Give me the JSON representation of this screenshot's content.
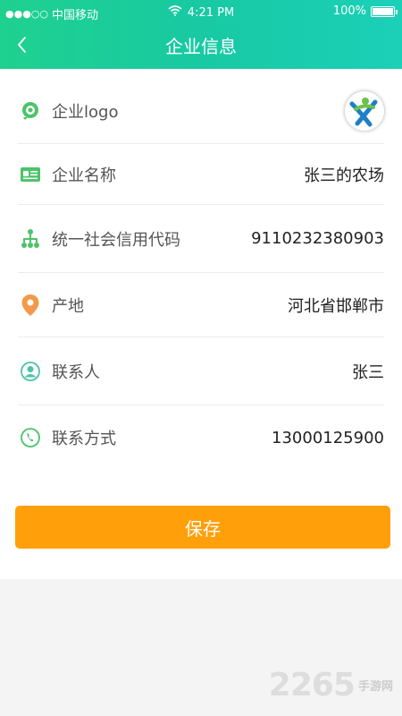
{
  "status_bar": {
    "signal": "●●●○○",
    "carrier": "中国移动",
    "time": "4:21 PM",
    "battery": "100%"
  },
  "nav": {
    "title": "企业信息"
  },
  "rows": [
    {
      "icon": "location-pin-green-icon",
      "label": "企业logo"
    },
    {
      "icon": "id-card-icon",
      "label": "企业名称",
      "value": "张三的农场"
    },
    {
      "icon": "org-tree-icon",
      "label": "统一社会信用代码",
      "value": "9110232380903"
    },
    {
      "icon": "location-pin-orange-icon",
      "label": "产地",
      "value": "河北省邯郸市"
    },
    {
      "icon": "person-icon",
      "label": "联系人",
      "value": "张三"
    },
    {
      "icon": "phone-icon",
      "label": "联系方式",
      "value": "13000125900"
    }
  ],
  "save_label": "保存",
  "watermark": {
    "number": "2265",
    "text": "手游网"
  },
  "colors": {
    "header_start": "#1fd18f",
    "header_end": "#1bd0b8",
    "save_button": "#ffa00a",
    "icon_green": "#4cc36a",
    "icon_orange": "#f29a4a"
  }
}
